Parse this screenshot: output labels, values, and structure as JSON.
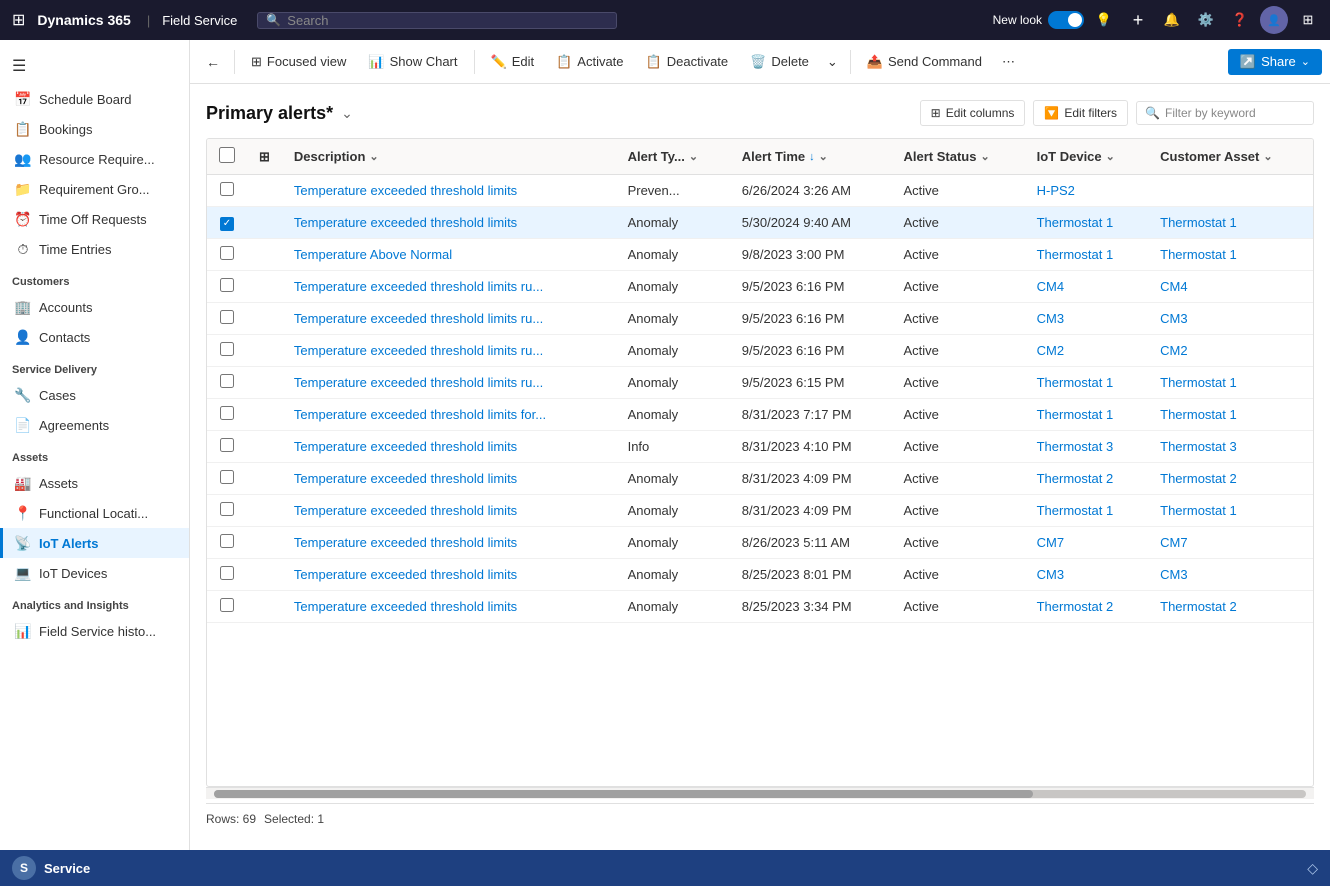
{
  "topNav": {
    "brand": "Dynamics 365",
    "divider": "|",
    "app": "Field Service",
    "searchPlaceholder": "Search",
    "newLook": "New look",
    "icons": [
      "lightbulb-icon",
      "plus-icon",
      "bell-icon",
      "settings-icon",
      "help-icon",
      "user-icon",
      "apps-icon"
    ]
  },
  "sidebar": {
    "hamburger": "☰",
    "sections": [
      {
        "items": [
          {
            "icon": "📅",
            "label": "Schedule Board",
            "active": false
          },
          {
            "icon": "📋",
            "label": "Bookings",
            "active": false
          },
          {
            "icon": "👥",
            "label": "Resource Require...",
            "active": false
          },
          {
            "icon": "📁",
            "label": "Requirement Gro...",
            "active": false
          },
          {
            "icon": "⏰",
            "label": "Time Off Requests",
            "active": false
          },
          {
            "icon": "⏱",
            "label": "Time Entries",
            "active": false
          }
        ]
      },
      {
        "label": "Customers",
        "items": [
          {
            "icon": "🏢",
            "label": "Accounts",
            "active": false
          },
          {
            "icon": "👤",
            "label": "Contacts",
            "active": false
          }
        ]
      },
      {
        "label": "Service Delivery",
        "items": [
          {
            "icon": "🔧",
            "label": "Cases",
            "active": false
          },
          {
            "icon": "📄",
            "label": "Agreements",
            "active": false
          }
        ]
      },
      {
        "label": "Assets",
        "items": [
          {
            "icon": "🏭",
            "label": "Assets",
            "active": false
          },
          {
            "icon": "📍",
            "label": "Functional Locati...",
            "active": false
          },
          {
            "icon": "📡",
            "label": "IoT Alerts",
            "active": true
          },
          {
            "icon": "💻",
            "label": "IoT Devices",
            "active": false
          }
        ]
      },
      {
        "label": "Analytics and Insights",
        "items": [
          {
            "icon": "📊",
            "label": "Field Service histo...",
            "active": false
          }
        ]
      }
    ]
  },
  "toolbar": {
    "back": "←",
    "focusedView": "Focused view",
    "showChart": "Show Chart",
    "edit": "Edit",
    "activate": "Activate",
    "deactivate": "Deactivate",
    "delete": "Delete",
    "moreOptions": "⌄",
    "sendCommand": "Send Command",
    "overflow": "⋯",
    "share": "Share",
    "shareChevron": "⌄"
  },
  "grid": {
    "title": "Primary alerts*",
    "dropdownIcon": "⌄",
    "editColumns": "Edit columns",
    "editFilters": "Edit filters",
    "filterPlaceholder": "Filter by keyword",
    "columns": [
      {
        "label": "Description",
        "sortable": true,
        "sorted": false
      },
      {
        "label": "Alert Ty...",
        "sortable": true,
        "sorted": false
      },
      {
        "label": "Alert Time",
        "sortable": true,
        "sorted": true,
        "sortDir": "↓"
      },
      {
        "label": "Alert Status",
        "sortable": true,
        "sorted": false
      },
      {
        "label": "IoT Device",
        "sortable": true,
        "sorted": false
      },
      {
        "label": "Customer Asset",
        "sortable": true,
        "sorted": false
      }
    ],
    "rows": [
      {
        "id": 1,
        "checked": false,
        "description": "Temperature exceeded threshold limits",
        "alertType": "Preven...",
        "alertTime": "6/26/2024 3:26 AM",
        "alertStatus": "Active",
        "iotDevice": "H-PS2",
        "iotDeviceLink": true,
        "customerAsset": "",
        "customerAssetLink": false,
        "selected": false
      },
      {
        "id": 2,
        "checked": true,
        "description": "Temperature exceeded threshold limits",
        "alertType": "Anomaly",
        "alertTime": "5/30/2024 9:40 AM",
        "alertStatus": "Active",
        "iotDevice": "Thermostat 1",
        "iotDeviceLink": true,
        "customerAsset": "Thermostat 1",
        "customerAssetLink": true,
        "selected": true
      },
      {
        "id": 3,
        "checked": false,
        "description": "Temperature Above Normal",
        "alertType": "Anomaly",
        "alertTime": "9/8/2023 3:00 PM",
        "alertStatus": "Active",
        "iotDevice": "Thermostat 1",
        "iotDeviceLink": true,
        "customerAsset": "Thermostat 1",
        "customerAssetLink": true,
        "selected": false
      },
      {
        "id": 4,
        "checked": false,
        "description": "Temperature exceeded threshold limits ru...",
        "alertType": "Anomaly",
        "alertTime": "9/5/2023 6:16 PM",
        "alertStatus": "Active",
        "iotDevice": "CM4",
        "iotDeviceLink": true,
        "customerAsset": "CM4",
        "customerAssetLink": true,
        "selected": false
      },
      {
        "id": 5,
        "checked": false,
        "description": "Temperature exceeded threshold limits ru...",
        "alertType": "Anomaly",
        "alertTime": "9/5/2023 6:16 PM",
        "alertStatus": "Active",
        "iotDevice": "CM3",
        "iotDeviceLink": true,
        "customerAsset": "CM3",
        "customerAssetLink": true,
        "selected": false
      },
      {
        "id": 6,
        "checked": false,
        "description": "Temperature exceeded threshold limits ru...",
        "alertType": "Anomaly",
        "alertTime": "9/5/2023 6:16 PM",
        "alertStatus": "Active",
        "iotDevice": "CM2",
        "iotDeviceLink": true,
        "customerAsset": "CM2",
        "customerAssetLink": true,
        "selected": false
      },
      {
        "id": 7,
        "checked": false,
        "description": "Temperature exceeded threshold limits ru...",
        "alertType": "Anomaly",
        "alertTime": "9/5/2023 6:15 PM",
        "alertStatus": "Active",
        "iotDevice": "Thermostat 1",
        "iotDeviceLink": true,
        "customerAsset": "Thermostat 1",
        "customerAssetLink": true,
        "selected": false
      },
      {
        "id": 8,
        "checked": false,
        "description": "Temperature exceeded threshold limits for...",
        "alertType": "Anomaly",
        "alertTime": "8/31/2023 7:17 PM",
        "alertStatus": "Active",
        "iotDevice": "Thermostat 1",
        "iotDeviceLink": true,
        "customerAsset": "Thermostat 1",
        "customerAssetLink": true,
        "selected": false
      },
      {
        "id": 9,
        "checked": false,
        "description": "Temperature exceeded threshold limits",
        "alertType": "Info",
        "alertTime": "8/31/2023 4:10 PM",
        "alertStatus": "Active",
        "iotDevice": "Thermostat 3",
        "iotDeviceLink": true,
        "customerAsset": "Thermostat 3",
        "customerAssetLink": true,
        "selected": false
      },
      {
        "id": 10,
        "checked": false,
        "description": "Temperature exceeded threshold limits",
        "alertType": "Anomaly",
        "alertTime": "8/31/2023 4:09 PM",
        "alertStatus": "Active",
        "iotDevice": "Thermostat 2",
        "iotDeviceLink": true,
        "customerAsset": "Thermostat 2",
        "customerAssetLink": true,
        "selected": false
      },
      {
        "id": 11,
        "checked": false,
        "description": "Temperature exceeded threshold limits",
        "alertType": "Anomaly",
        "alertTime": "8/31/2023 4:09 PM",
        "alertStatus": "Active",
        "iotDevice": "Thermostat 1",
        "iotDeviceLink": true,
        "customerAsset": "Thermostat 1",
        "customerAssetLink": true,
        "selected": false
      },
      {
        "id": 12,
        "checked": false,
        "description": "Temperature exceeded threshold limits",
        "alertType": "Anomaly",
        "alertTime": "8/26/2023 5:11 AM",
        "alertStatus": "Active",
        "iotDevice": "CM7",
        "iotDeviceLink": true,
        "customerAsset": "CM7",
        "customerAssetLink": true,
        "selected": false
      },
      {
        "id": 13,
        "checked": false,
        "description": "Temperature exceeded threshold limits",
        "alertType": "Anomaly",
        "alertTime": "8/25/2023 8:01 PM",
        "alertStatus": "Active",
        "iotDevice": "CM3",
        "iotDeviceLink": true,
        "customerAsset": "CM3",
        "customerAssetLink": true,
        "selected": false
      },
      {
        "id": 14,
        "checked": false,
        "description": "Temperature exceeded threshold limits",
        "alertType": "Anomaly",
        "alertTime": "8/25/2023 3:34 PM",
        "alertStatus": "Active",
        "iotDevice": "Thermostat 2",
        "iotDeviceLink": true,
        "customerAsset": "Thermostat 2",
        "customerAssetLink": true,
        "selected": false
      }
    ],
    "footer": {
      "rows": "Rows: 69",
      "selected": "Selected: 1"
    }
  },
  "bottomNav": {
    "iconLabel": "S",
    "label": "Service",
    "pinIcon": "◇"
  }
}
